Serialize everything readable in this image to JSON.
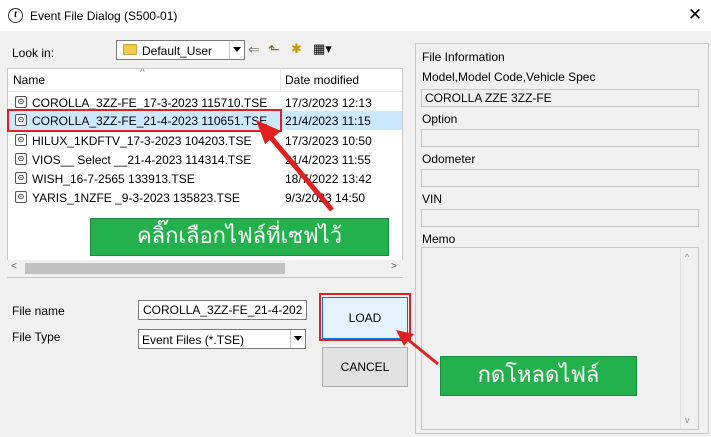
{
  "window": {
    "title": "Event File Dialog (S500-01)",
    "close_glyph": "✕"
  },
  "look_in": {
    "label": "Look in:",
    "value": "Default_User"
  },
  "toolbar": {
    "back_glyph": "⇐",
    "up_glyph": "⬑",
    "new_folder_glyph": "✱",
    "view_glyph": "▦▾"
  },
  "file_list": {
    "col_name": "Name",
    "col_date": "Date modified",
    "sort_glyph": "^",
    "file_icon_glyph": "⊙",
    "files": [
      {
        "name": "COROLLA_3ZZ-FE_17-3-2023 115710.TSE",
        "date": "17/3/2023 12:13",
        "selected": false
      },
      {
        "name": "COROLLA_3ZZ-FE_21-4-2023 110651.TSE",
        "date": "21/4/2023 11:15",
        "selected": true
      },
      {
        "name": "HILUX_1KDFTV_17-3-2023 104203.TSE",
        "date": "17/3/2023 10:50",
        "selected": false
      },
      {
        "name": "VIOS__ Select __21-4-2023 114314.TSE",
        "date": "21/4/2023 11:55",
        "selected": false
      },
      {
        "name": "WISH_16-7-2565 133913.TSE",
        "date": "18/7/2022 13:42",
        "selected": false
      },
      {
        "name": "YARIS_1NZFE _9-3-2023 135823.TSE",
        "date": "9/3/2023 14:50",
        "selected": false
      }
    ]
  },
  "scroll": {
    "left_glyph": "<",
    "right_glyph": ">",
    "up_glyph": "^",
    "down_glyph": "v"
  },
  "file_name": {
    "label": "File name",
    "value": "COROLLA_3ZZ-FE_21-4-202"
  },
  "file_type": {
    "label": "File Type",
    "value": "Event Files (*.TSE)"
  },
  "buttons": {
    "load": "LOAD",
    "cancel": "CANCEL"
  },
  "info": {
    "section_title": "File Information",
    "model_label": "Model,Model Code,Vehicle Spec",
    "model_value": "COROLLA ZZE 3ZZ-FE",
    "option_label": "Option",
    "option_value": "",
    "odometer_label": "Odometer",
    "odometer_value": "",
    "vin_label": "VIN",
    "vin_value": "",
    "memo_label": "Memo"
  },
  "annotations": {
    "select_file": "คลิ๊กเลือกไฟล์ที่เซฟไว้",
    "load_file": "กดโหลดไฟล์",
    "color_red": "#e02020",
    "color_green": "#22b14c"
  }
}
